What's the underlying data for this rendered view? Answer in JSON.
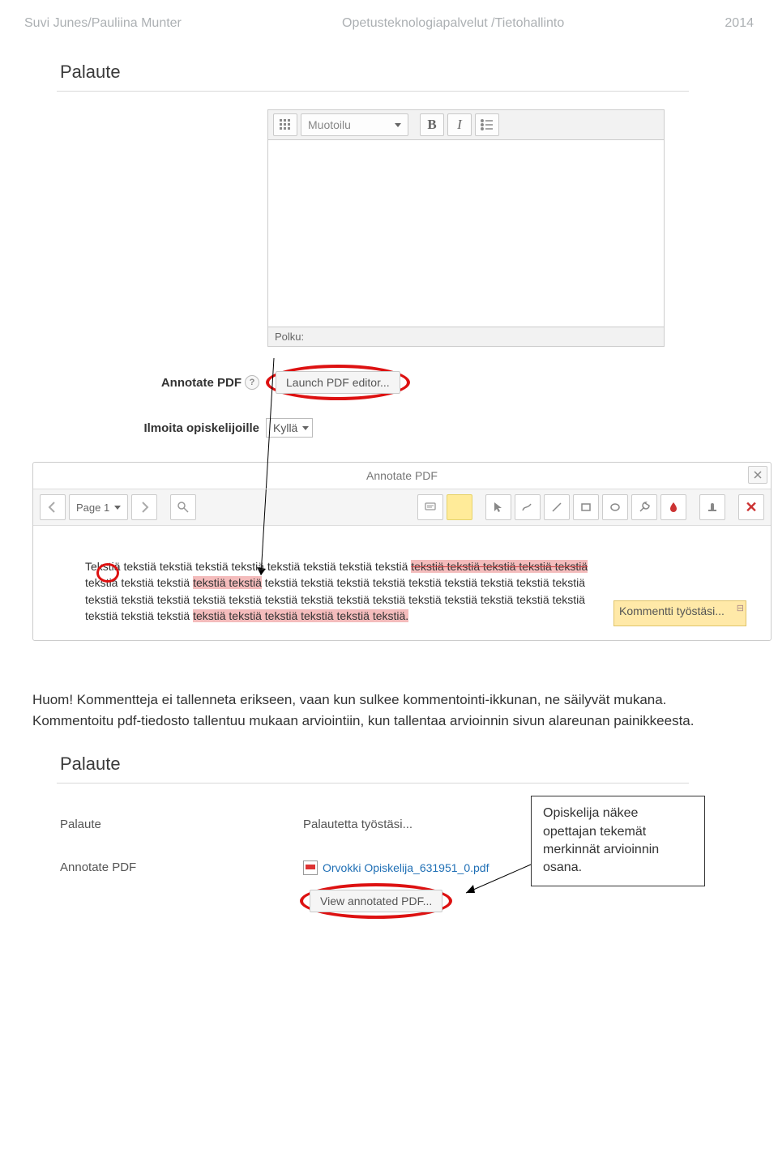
{
  "header": {
    "left": "Suvi Junes/Pauliina Munter",
    "center": "Opetusteknologiapalvelut /Tietohallinto",
    "right": "2014"
  },
  "panel1": {
    "title": "Palaute",
    "toolbar": {
      "format_label": "Muotoilu",
      "bold": "B",
      "italic": "I"
    },
    "path_label": "Polku:",
    "annotate_label": "Annotate PDF",
    "launch_button": "Launch PDF editor...",
    "notify_label": "Ilmoita opiskelijoille",
    "notify_value": "Kyllä"
  },
  "pdf": {
    "title": "Annotate PDF",
    "page_label": "Page 1",
    "body_line1a": "Tekstiä",
    "body_line1b": "tekstiä tekstiä tekstiä tekstiä tekstiä tekstiä tekstiä tekstiä",
    "body_line1c": "tekstiä tekstiä tekstiä tekstiä tekstiä",
    "body_line2a": "tekstiä tekstiä tekstiä",
    "body_line2b": "tekstiä tekstiä",
    "body_line2c": "tekstiä tekstiä tekstiä tekstiä tekstiä tekstiä tekstiä tekstiä tekstiä",
    "body_line3": "tekstiä tekstiä tekstiä tekstiä tekstiä tekstiä tekstiä tekstiä tekstiä tekstiä tekstiä tekstiä tekstiä tekstiä",
    "body_line4a": "tekstiä tekstiä tekstiä",
    "body_line4b": "tekstiä tekstiä tekstiä tekstiä tekstiä tekstiä.",
    "comment": "Kommentti työstäsi..."
  },
  "note": "Huom! Kommentteja ei tallenneta erikseen, vaan kun sulkee kommentointi-ikkunan, ne säilyvät mukana. Kommentoitu pdf-tiedosto tallentuu mukaan arviointiin, kun tallentaa arvioinnin sivun alareunan painikkeesta.",
  "callout": "Opiskelija näkee opettajan tekemät merkinnät arvioinnin osana.",
  "panel2": {
    "title": "Palaute",
    "row1_label": "Palaute",
    "row1_value": "Palautetta työstäsi...",
    "row2_label": "Annotate PDF",
    "file_name": "Orvokki Opiskelija_631951_0.pdf",
    "view_button": "View annotated PDF..."
  }
}
